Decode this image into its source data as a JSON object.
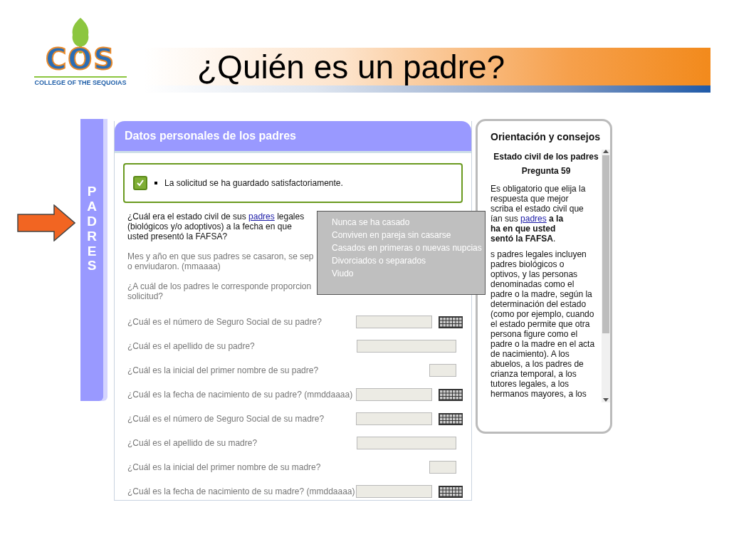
{
  "slide": {
    "logo": {
      "letters": "COS",
      "college": "COLLEGE OF THE SEQUOIAS"
    },
    "title": "¿Quién es un padre?"
  },
  "side_tab": {
    "label": "PADRES"
  },
  "form": {
    "title": "Datos personales de los padres",
    "notice": {
      "checked": true,
      "text": "La solicitud se ha guardado satisfactoriamente."
    },
    "questions": [
      {
        "disabled": false,
        "before": "¿Cuál era el estado civil de sus ",
        "link": "padres",
        "after": " legales\n(biológicos y/o adoptivos) a la fecha en que\nusted presentó la FAFSA?"
      },
      {
        "disabled": true,
        "before": "Mes y año en que sus padres se casaron, se sep\no enviudaron. (mmaaaa)"
      },
      {
        "disabled": true,
        "before": "¿A cuál de los padres le corresponde proporcion\nsolicitud?"
      }
    ],
    "fields": [
      {
        "label": "¿Cuál es el número de Seguro Social de su padre?",
        "kind": "medium",
        "keypad": true
      },
      {
        "label": "¿Cuál es el apellido de su padre?",
        "kind": "wide",
        "keypad": false
      },
      {
        "label": "¿Cuál es la inicial del primer nombre de su padre?",
        "kind": "small",
        "keypad": false
      },
      {
        "label": "¿Cuál es la fecha de nacimiento de su padre? (mmddaaaa)",
        "kind": "medium",
        "keypad": true
      },
      {
        "label": "¿Cuál es el número de Seguro Social de su madre?",
        "kind": "medium",
        "keypad": true
      },
      {
        "label": "¿Cuál es el apellido de su madre?",
        "kind": "wide",
        "keypad": false
      },
      {
        "label": "¿Cuál es la inicial del primer nombre de su madre?",
        "kind": "small",
        "keypad": false
      },
      {
        "label": "¿Cuál es la fecha de nacimiento de su madre? (mmddaaaa)",
        "kind": "medium",
        "keypad": true
      }
    ],
    "dropdown": {
      "options": [
        "Nunca se ha casado",
        "Conviven en pareja sin casarse",
        "Casados en primeras o nuevas nupcias",
        "Divorciados o separados",
        "Viudo"
      ]
    }
  },
  "guide": {
    "title": "Orientación y consejos",
    "topic": "Estado civil de los padres",
    "question": "Pregunta 59",
    "paragraphs": [
      [
        {
          "text": "Es obligatorio que elija la\nrespuesta que mejor\nscriba el estado civil que\nían sus "
        },
        {
          "link": "padres"
        },
        {
          "text": " **a la**\n**ha en que usted**\n**sentó la FAFSA**."
        }
      ],
      [
        {
          "text": "s padres legales incluyen\npadres biológicos o\noptivos, y las personas\ndenominadas como el\npadre o la madre, según la\ndeterminación del estado\n(como por ejemplo, cuando\nel estado permite que otra\npersona figure como el\npadre o la madre en el acta\nde nacimiento). A los\nabuelos, a los padres de\ncrianza temporal, a los\ntutores legales, a los\nhermanos mayores, a los"
        }
      ]
    ]
  }
}
